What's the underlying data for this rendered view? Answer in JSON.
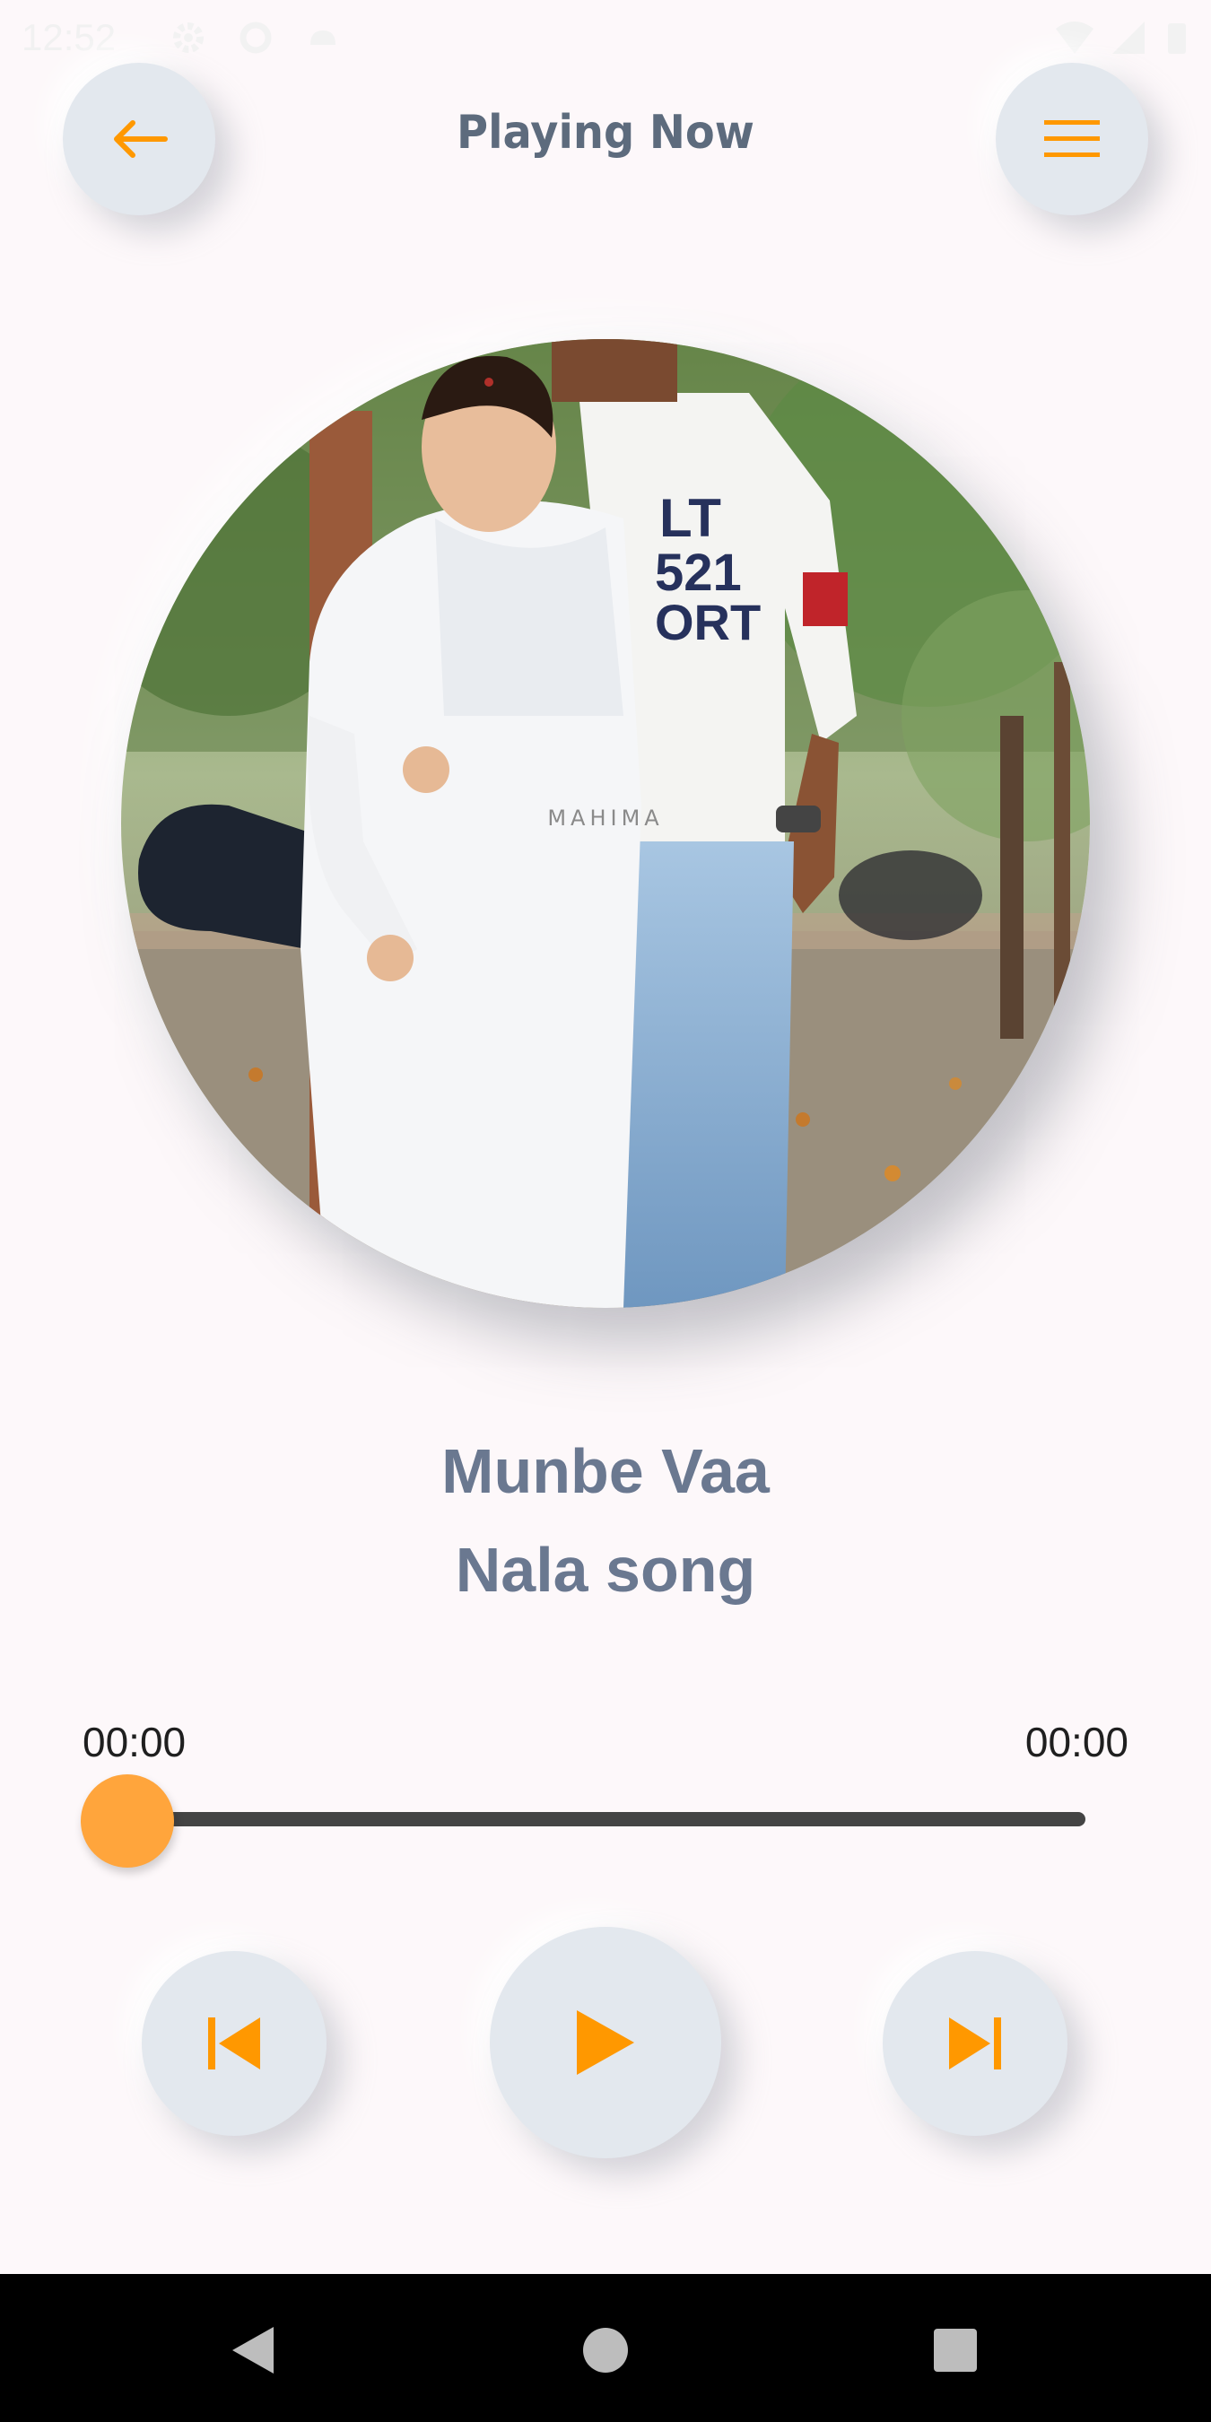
{
  "status_bar": {
    "time": "12:52",
    "icons": [
      "settings-icon",
      "data-saver-icon",
      "android-icon",
      "wifi-icon",
      "signal-icon",
      "battery-icon"
    ]
  },
  "header": {
    "title": "Playing Now",
    "back_icon": "arrow-left-icon",
    "menu_icon": "hamburger-menu-icon"
  },
  "album_art": {
    "watermark": "MAHIMA"
  },
  "track": {
    "title": "Munbe Vaa",
    "subtitle": "Nala song"
  },
  "progress": {
    "elapsed": "00:00",
    "duration": "00:00",
    "fraction": 0
  },
  "controls": {
    "previous_icon": "skip-previous-icon",
    "play_icon": "play-icon",
    "next_icon": "skip-next-icon"
  },
  "navigation_bar": {
    "icons": [
      "back-triangle-icon",
      "home-circle-icon",
      "recents-square-icon"
    ]
  },
  "colors": {
    "accent": "#ffa53c",
    "icon_orange": "#ff9800",
    "text_slate": "#6a7890",
    "button_bg": "#e3e8ee",
    "background": "#fdf8fa"
  }
}
